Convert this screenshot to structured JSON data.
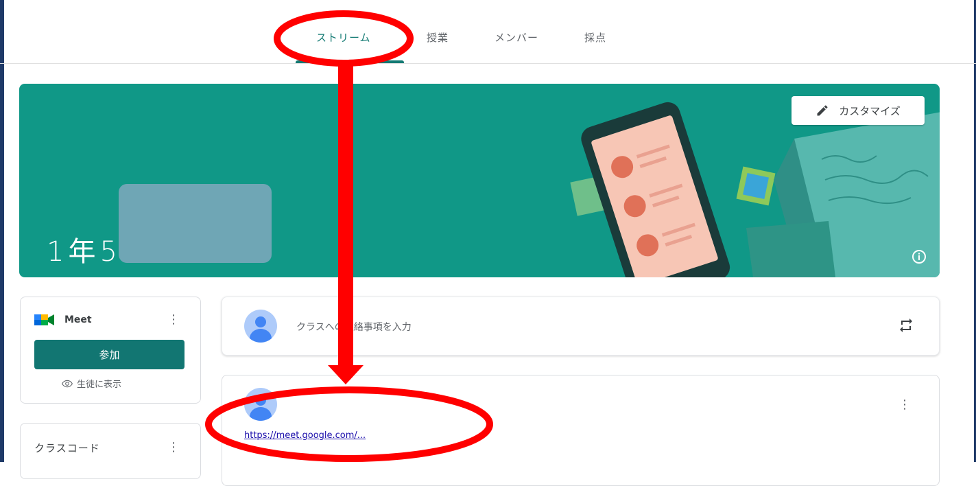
{
  "tabs": [
    {
      "label": "ストリーム",
      "active": true
    },
    {
      "label": "授業"
    },
    {
      "label": "メンバー"
    },
    {
      "label": "採点"
    }
  ],
  "banner": {
    "class_title": "1年5",
    "customize_label": "カスタマイズ",
    "color": "#109887"
  },
  "meet_card": {
    "title": "Meet",
    "join_label": "参加",
    "show_students_label": "生徒に表示"
  },
  "class_code_card": {
    "label": "クラスコード"
  },
  "post_box": {
    "placeholder": "クラスへの連絡事項を入力"
  },
  "stream_post": {
    "link_text": "https://meet.google.com/..."
  },
  "colors": {
    "accent": "#137a73",
    "annotation": "#ff0000"
  }
}
